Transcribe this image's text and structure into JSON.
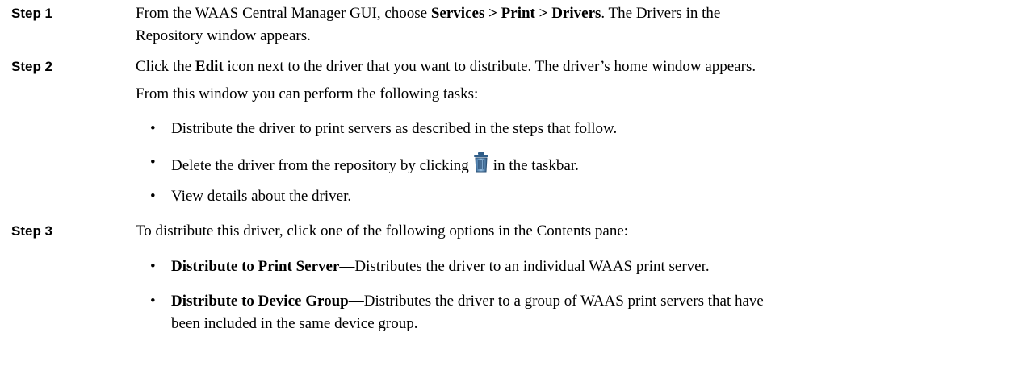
{
  "steps": [
    {
      "label": "Step 1",
      "p1": "From the WAAS Central Manager GUI, choose ",
      "bold1": "Services > Print > Drivers",
      "p2": ". The Drivers in the",
      "line2": "Repository window appears."
    },
    {
      "label": "Step 2",
      "p1": "Click the ",
      "bold1": "Edit",
      "p2": " icon next to the driver that you want to distribute. The driver’s home window appears.",
      "line2": "From this window you can perform the following tasks:",
      "bullets": [
        {
          "text": "Distribute the driver to print servers as described in the steps that follow."
        },
        {
          "before": "Delete the driver from the repository by clicking",
          "after": "in the taskbar.",
          "icon": "trash-icon"
        },
        {
          "text": "View details about the driver."
        }
      ]
    },
    {
      "label": "Step 3",
      "p1": "To distribute this driver, click one of the following options in the Contents pane:",
      "bullets": [
        {
          "bold": "Distribute to Print Server",
          "rest": "—Distributes the driver to an individual WAAS print server."
        },
        {
          "bold": "Distribute to Device Group",
          "rest": "—Distributes the driver to a group of WAAS print servers that have",
          "cont": "been included in the same device group."
        }
      ]
    }
  ],
  "bullet_glyph": "•"
}
